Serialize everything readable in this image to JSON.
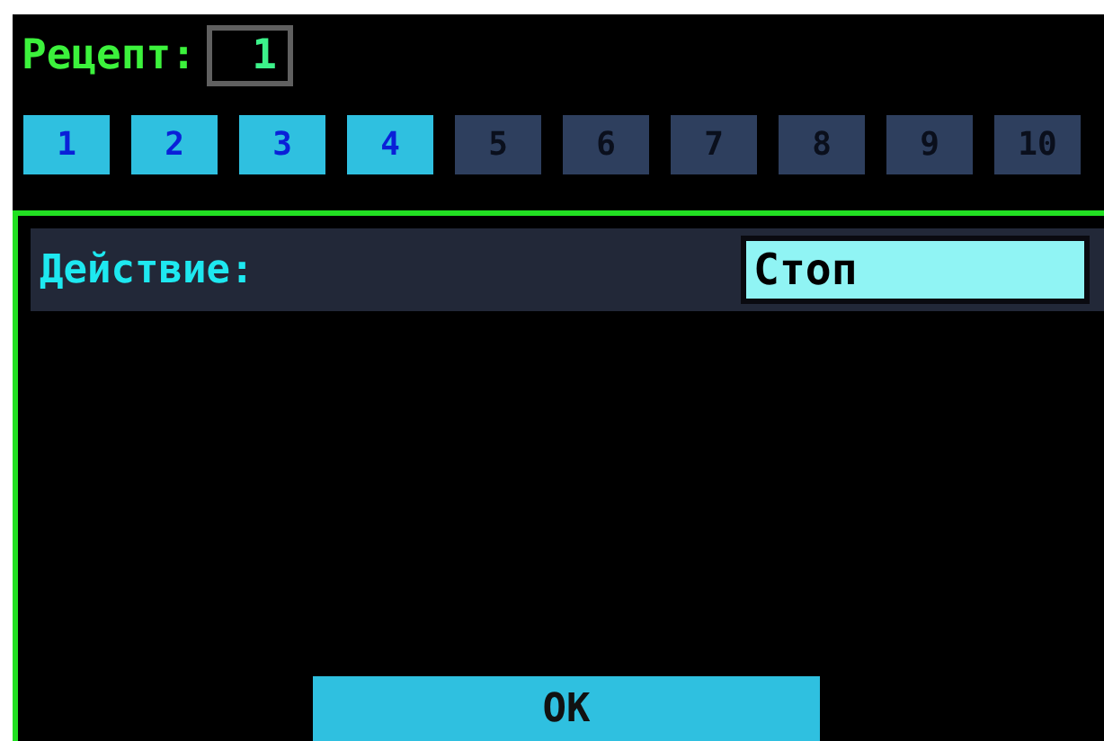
{
  "header": {
    "label": "Рецепт:",
    "value": "1"
  },
  "tabs": [
    {
      "label": "1",
      "enabled": true
    },
    {
      "label": "2",
      "enabled": true
    },
    {
      "label": "3",
      "enabled": true
    },
    {
      "label": "4",
      "enabled": true
    },
    {
      "label": "5",
      "enabled": false
    },
    {
      "label": "6",
      "enabled": false
    },
    {
      "label": "7",
      "enabled": false
    },
    {
      "label": "8",
      "enabled": false
    },
    {
      "label": "9",
      "enabled": false
    },
    {
      "label": "10",
      "enabled": false
    }
  ],
  "action": {
    "label": "Действие:",
    "value": "Стоп"
  },
  "buttons": [
    "OK"
  ]
}
